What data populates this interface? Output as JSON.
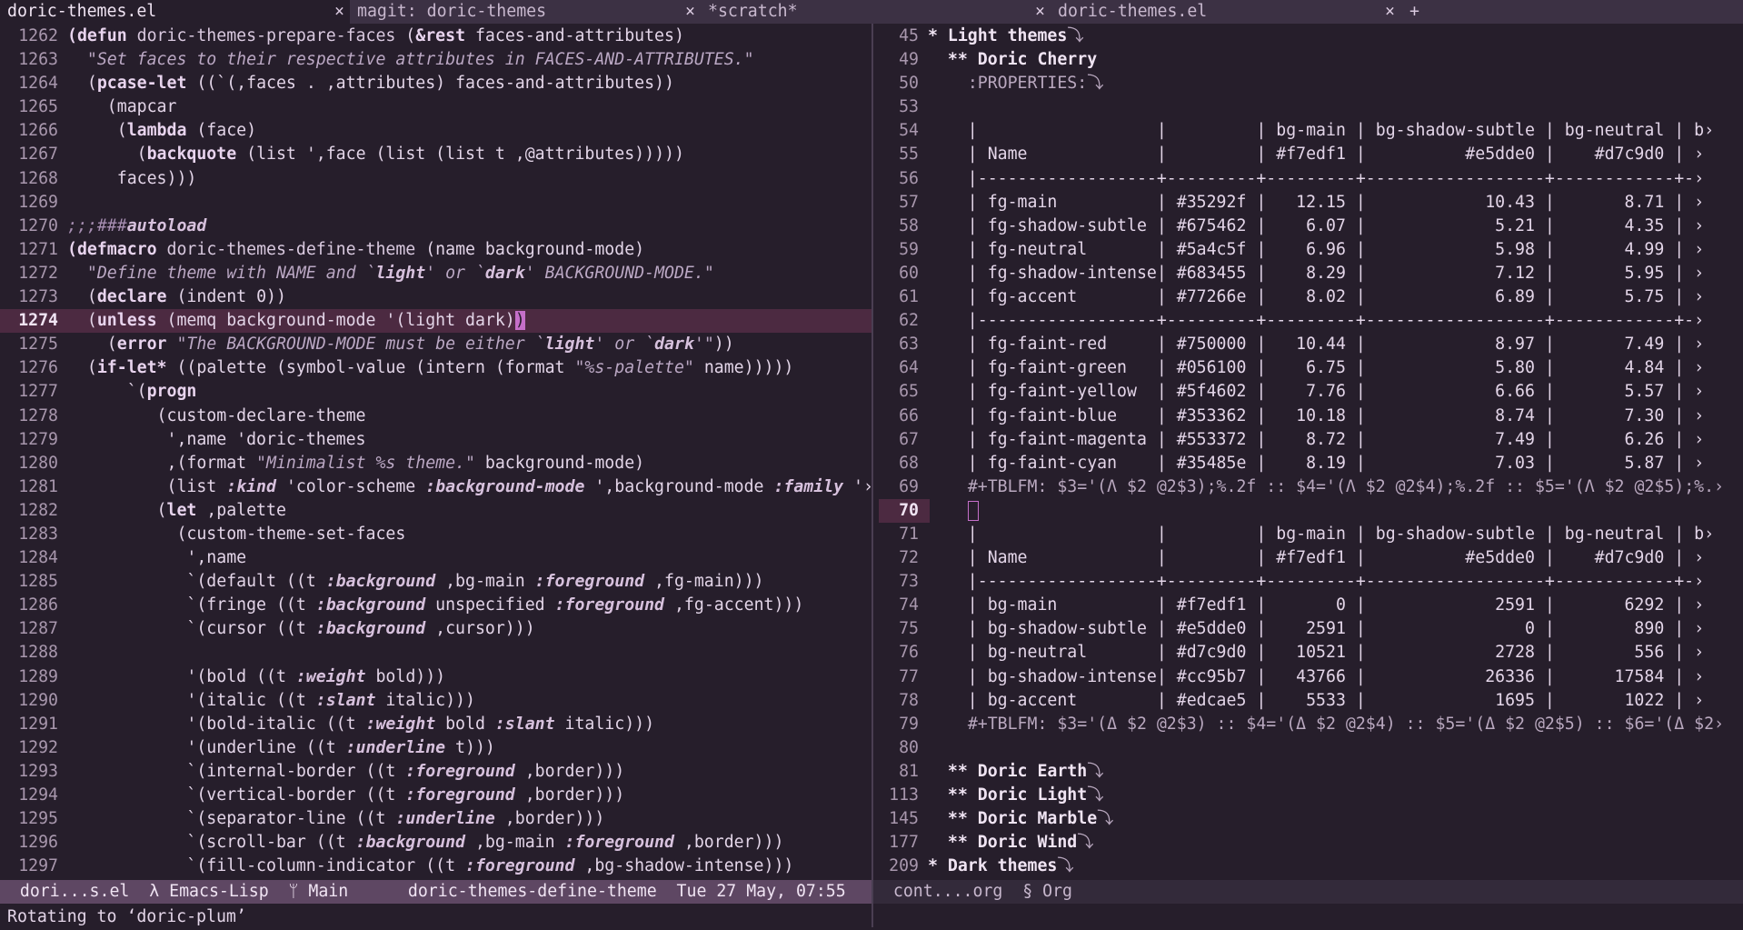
{
  "tabs": [
    {
      "label": "doric-themes.el",
      "width": 385,
      "active": true
    },
    {
      "label": "magit: doric-themes",
      "width": 386,
      "active": false
    },
    {
      "label": "*scratch*",
      "width": 385,
      "active": false
    },
    {
      "label": "doric-themes.el",
      "width": 385,
      "active": false
    }
  ],
  "tab_close": "×",
  "tab_new": "+",
  "left_lines": [
    [
      "1262",
      "<span class=\"kw\">(defun</span> <span class=\"fn\">doric-themes-prepare-faces</span> (<span class=\"kw\">&amp;rest</span> faces-and-attributes)"
    ],
    [
      "1263",
      "  <span class=\"str\">\"Set faces to their respective attributes in FACES-AND-ATTRIBUTES.\"</span>"
    ],
    [
      "1264",
      "  (<span class=\"kw\">pcase-let</span> ((`(,faces . ,attributes) faces-and-attributes))"
    ],
    [
      "1265",
      "    (mapcar"
    ],
    [
      "1266",
      "     (<span class=\"kw\">lambda</span> (face)"
    ],
    [
      "1267",
      "       (<span class=\"kw\">backquote</span> (list ',face (list (list t ,@attributes)))))"
    ],
    [
      "1268",
      "     faces)))"
    ],
    [
      "1269",
      ""
    ],
    [
      "1270",
      "<span class=\"cmt\">;;;###</span><span class=\"key\">autoload</span>"
    ],
    [
      "1271",
      "<span class=\"kw\">(defmacro</span> <span class=\"fn\">doric-themes-define-theme</span> (name background-mode)"
    ],
    [
      "1272",
      "  <span class=\"str\">\"Define theme with NAME and `</span><span class=\"key\">light</span><span class=\"str\">' or `</span><span class=\"key\">dark</span><span class=\"str\">' BACKGROUND-MODE.\"</span>"
    ],
    [
      "1273",
      "  (<span class=\"kw\">declare</span> (indent 0))"
    ],
    [
      "1274",
      "  (<span class=\"kw\">unless</span> (memq background-mode '(light dark)<span class=\"cursor\">)</span>"
    ],
    [
      "1275",
      "    (<span class=\"kw\">error</span> <span class=\"str\">\"The BACKGROUND-MODE must be either `</span><span class=\"key\">light</span><span class=\"str\">' or `</span><span class=\"key\">dark</span><span class=\"str\">'\"</span>))"
    ],
    [
      "1276",
      "  (<span class=\"kw\">if-let*</span> ((palette (symbol-value (intern (format <span class=\"str\">\"%s-palette\"</span> name)))))"
    ],
    [
      "1277",
      "      `(<span class=\"kw\">progn</span>"
    ],
    [
      "1278",
      "         (custom-declare-theme"
    ],
    [
      "1279",
      "          ',name 'doric-themes"
    ],
    [
      "1280",
      "          ,(format <span class=\"str\">\"Minimalist %s theme.\"</span> background-mode)"
    ],
    [
      "1281",
      "          (list <span class=\"key\">:kind</span> 'color-scheme <span class=\"key\">:background-mode</span> ',background-mode <span class=\"key\">:family</span> '›"
    ],
    [
      "1282",
      "         (<span class=\"kw\">let</span> ,palette"
    ],
    [
      "1283",
      "           (custom-theme-set-faces"
    ],
    [
      "1284",
      "            ',name"
    ],
    [
      "1285",
      "            `(default ((t <span class=\"key\">:background</span> ,bg-main <span class=\"key\">:foreground</span> ,fg-main)))"
    ],
    [
      "1286",
      "            `(fringe ((t <span class=\"key\">:background</span> unspecified <span class=\"key\">:foreground</span> ,fg-accent)))"
    ],
    [
      "1287",
      "            `(cursor ((t <span class=\"key\">:background</span> ,cursor)))"
    ],
    [
      "1288",
      ""
    ],
    [
      "1289",
      "            '(bold ((t <span class=\"key\">:weight</span> bold)))"
    ],
    [
      "1290",
      "            '(italic ((t <span class=\"key\">:slant</span> italic)))"
    ],
    [
      "1291",
      "            '(bold-italic ((t <span class=\"key\">:weight</span> bold <span class=\"key\">:slant</span> italic)))"
    ],
    [
      "1292",
      "            '(underline ((t <span class=\"key\">:underline</span> t)))"
    ],
    [
      "1293",
      "            `(internal-border ((t <span class=\"key\">:foreground</span> ,border)))"
    ],
    [
      "1294",
      "            `(vertical-border ((t <span class=\"key\">:foreground</span> ,border)))"
    ],
    [
      "1295",
      "            `(separator-line ((t <span class=\"key\">:underline</span> ,border)))"
    ],
    [
      "1296",
      "            `(scroll-bar ((t <span class=\"key\">:background</span> ,bg-main <span class=\"key\">:foreground</span> ,border)))"
    ],
    [
      "1297",
      "            `(fill-column-indicator ((t <span class=\"key\">:foreground</span> ,bg-shadow-intense)))"
    ]
  ],
  "left_highlight_line": "1274",
  "right_lines": [
    [
      "45",
      "<span class=\"head\">* Light themes</span><span class=\"meta\">⤵</span>"
    ],
    [
      "49",
      "  <span class=\"head\">** Doric Cherry</span>"
    ],
    [
      "50",
      "    <span class=\"meta\">:PROPERTIES:⤵</span>"
    ],
    [
      "53",
      ""
    ],
    [
      "54",
      "    |                  |         | bg-main | bg-shadow-subtle | bg-neutral | b›"
    ],
    [
      "55",
      "    | Name             |         | #f7edf1 |          #e5dde0 |    #d7c9d0 | ›"
    ],
    [
      "56",
      "    |------------------+---------+---------+------------------+------------+-›"
    ],
    [
      "57",
      "    | fg-main          | #35292f |   12.15 |            10.43 |       8.71 | ›"
    ],
    [
      "58",
      "    | fg-shadow-subtle | #675462 |    6.07 |             5.21 |       4.35 | ›"
    ],
    [
      "59",
      "    | fg-neutral       | #5a4c5f |    6.96 |             5.98 |       4.99 | ›"
    ],
    [
      "60",
      "    | fg-shadow-intense| #683455 |    8.29 |             7.12 |       5.95 | ›"
    ],
    [
      "61",
      "    | fg-accent        | #77266e |    8.02 |             6.89 |       5.75 | ›"
    ],
    [
      "62",
      "    |------------------+---------+---------+------------------+------------+-›"
    ],
    [
      "63",
      "    | fg-faint-red     | #750000 |   10.44 |             8.97 |       7.49 | ›"
    ],
    [
      "64",
      "    | fg-faint-green   | #056100 |    6.75 |             5.80 |       4.84 | ›"
    ],
    [
      "65",
      "    | fg-faint-yellow  | #5f4602 |    7.76 |             6.66 |       5.57 | ›"
    ],
    [
      "66",
      "    | fg-faint-blue    | #353362 |   10.18 |             8.74 |       7.30 | ›"
    ],
    [
      "67",
      "    | fg-faint-magenta | #553372 |    8.72 |             7.49 |       6.26 | ›"
    ],
    [
      "68",
      "    | fg-faint-cyan    | #35485e |    8.19 |             7.03 |       5.87 | ›"
    ],
    [
      "69",
      "    <span class=\"meta\">#+TBLFM: $3='(Λ $2 @2$3);%.2f :: $4='(Λ $2 @2$4);%.2f :: $5='(Λ $2 @2$5);%.›</span>"
    ],
    [
      "70",
      "    <span class=\"cursor-box\"></span>"
    ],
    [
      "71",
      "    |                  |         | bg-main | bg-shadow-subtle | bg-neutral | b›"
    ],
    [
      "72",
      "    | Name             |         | #f7edf1 |          #e5dde0 |    #d7c9d0 | ›"
    ],
    [
      "73",
      "    |------------------+---------+---------+------------------+------------+-›"
    ],
    [
      "74",
      "    | bg-main          | #f7edf1 |       0 |             2591 |       6292 | ›"
    ],
    [
      "75",
      "    | bg-shadow-subtle | #e5dde0 |    2591 |                0 |        890 | ›"
    ],
    [
      "76",
      "    | bg-neutral       | #d7c9d0 |   10521 |             2728 |        556 | ›"
    ],
    [
      "77",
      "    | bg-shadow-intense| #cc95b7 |   43766 |            26336 |      17584 | ›"
    ],
    [
      "78",
      "    | bg-accent        | #edcae5 |    5533 |             1695 |       1022 | ›"
    ],
    [
      "79",
      "    <span class=\"meta\">#+TBLFM: $3='(Δ $2 @2$3) :: $4='(Δ $2 @2$4) :: $5='(Δ $2 @2$5) :: $6='(Δ $2›</span>"
    ],
    [
      "80",
      ""
    ],
    [
      "81",
      "  <span class=\"head\">** Doric Earth</span><span class=\"meta\">⤵</span>"
    ],
    [
      "113",
      "  <span class=\"head\">** Doric Light</span><span class=\"meta\">⤵</span>"
    ],
    [
      "145",
      "  <span class=\"head\">** Doric Marble</span><span class=\"meta\">⤵</span>"
    ],
    [
      "177",
      "  <span class=\"head\">** Doric Wind</span><span class=\"meta\">⤵</span>"
    ],
    [
      "209",
      "<span class=\"head\">* Dark themes</span><span class=\"meta\">⤵</span>"
    ]
  ],
  "right_highlight_line": "70",
  "modeline_left": "  dori...s.el  λ Emacs-Lisp  ᛘ Main      doric-themes-define-theme  Tue 27 May, 07:55",
  "modeline_right": "  cont....org  § Org",
  "minibuffer": "Rotating to ‘doric-plum’"
}
